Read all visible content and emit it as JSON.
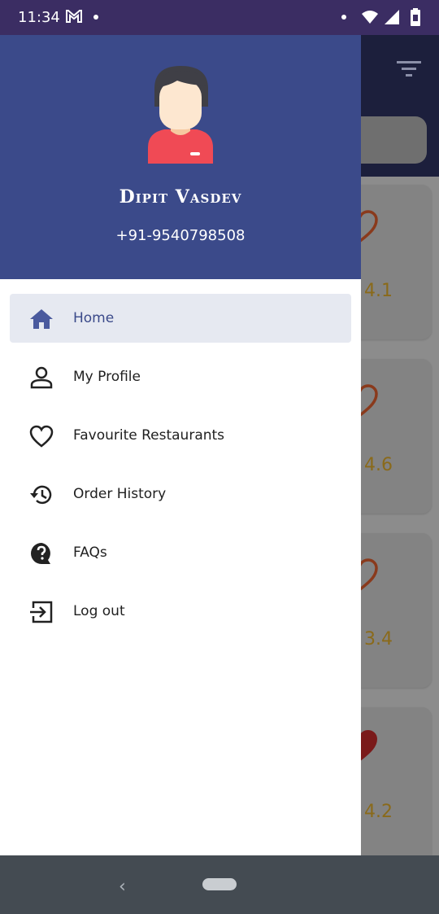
{
  "status_bar": {
    "time": "11:34",
    "icons": [
      "gmail-icon",
      "notification-dot-icon",
      "wifi-icon",
      "signal-icon",
      "battery-icon"
    ],
    "background": "#3b2d63"
  },
  "drawer": {
    "header_color": "#3b4a8a",
    "user_name": "Dipit Vasdev",
    "phone": "+91-9540798508",
    "menu": [
      {
        "label": "Home",
        "icon": "home-icon",
        "active": true
      },
      {
        "label": "My Profile",
        "icon": "person-icon",
        "active": false
      },
      {
        "label": "Favourite Restaurants",
        "icon": "heart-outline-icon",
        "active": false
      },
      {
        "label": "Order History",
        "icon": "history-icon",
        "active": false
      },
      {
        "label": "FAQs",
        "icon": "faq-icon",
        "active": false
      },
      {
        "label": "Log out",
        "icon": "logout-icon",
        "active": false
      }
    ]
  },
  "background_list": {
    "ratings": [
      "4.1",
      "4.6",
      "3.4",
      "4.2"
    ],
    "favourited": [
      false,
      false,
      false,
      true
    ]
  },
  "colors": {
    "accent": "#3b4a8a",
    "active_item_bg": "#e6e9f1",
    "heart": "#8a3a1c",
    "rating_text": "#8a6a1a"
  }
}
